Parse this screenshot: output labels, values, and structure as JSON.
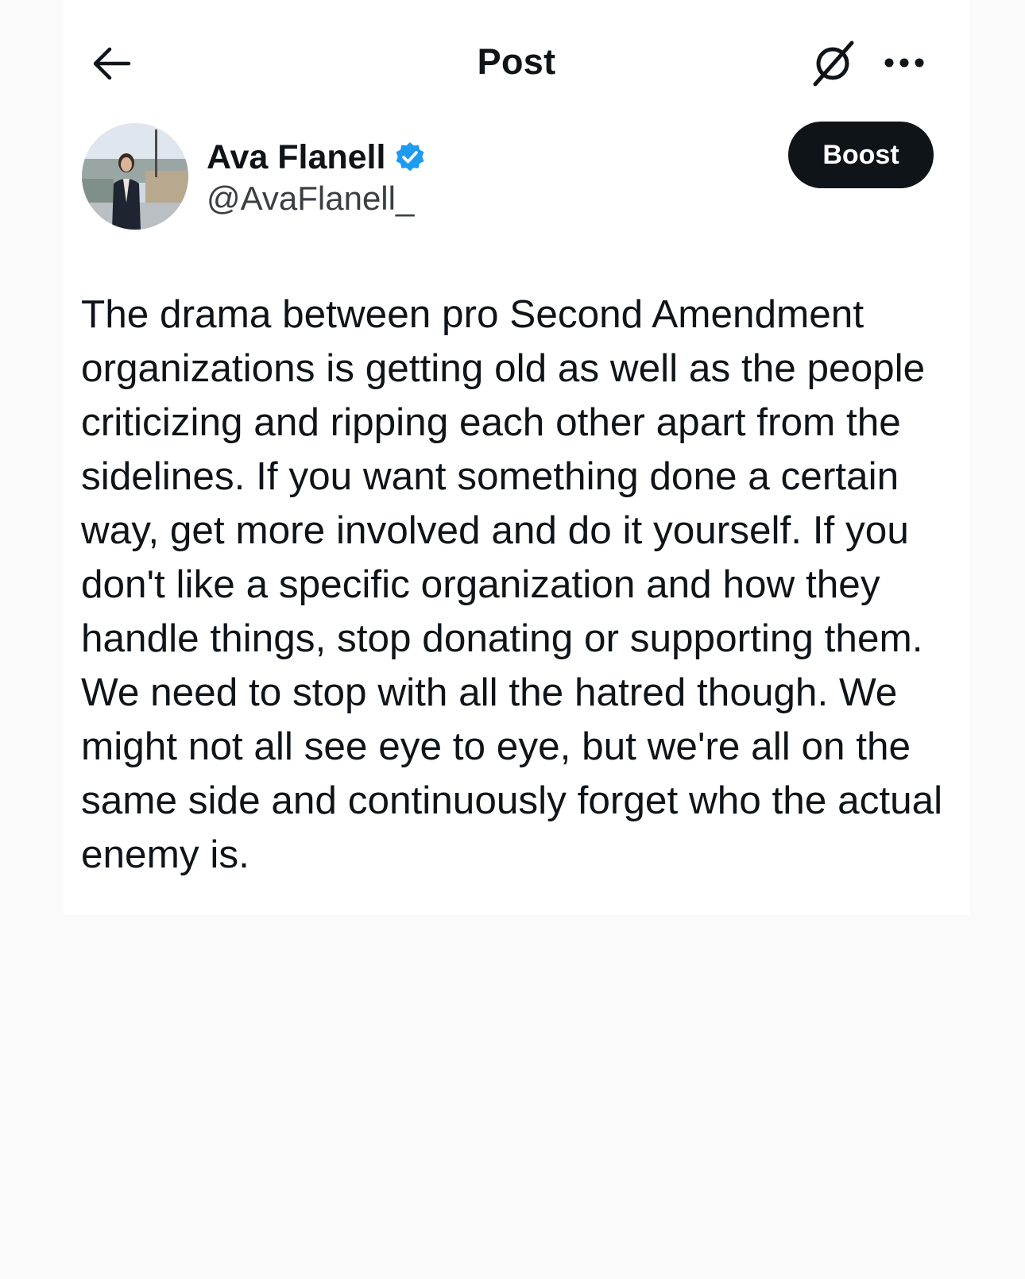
{
  "header": {
    "title": "Post",
    "back_icon": "arrow-left-icon",
    "grok_icon": "grok-slash-icon",
    "more_icon": "more-horizontal-icon"
  },
  "author": {
    "name": "Ava Flanell",
    "handle": "@AvaFlanell_",
    "verified": true,
    "verified_color": "#1d9bf0",
    "avatar_icon": "profile-photo"
  },
  "actions": {
    "boost_label": "Boost"
  },
  "post": {
    "text": "The drama between pro Second Amendment organizations is getting old as well as the people criticizing and ripping each other apart from the sidelines. If you want something done a certain way, get more involved and do it yourself. If you don't like a specific organization and how they handle things, stop donating or supporting them. We need to stop with all the hatred though. We might not all see eye to eye, but we're all on the same side and  continuously forget who the actual enemy is."
  },
  "colors": {
    "text": "#0f1419",
    "button_bg": "#0f1419",
    "page_bg": "#fafafa",
    "card_bg": "#ffffff"
  }
}
